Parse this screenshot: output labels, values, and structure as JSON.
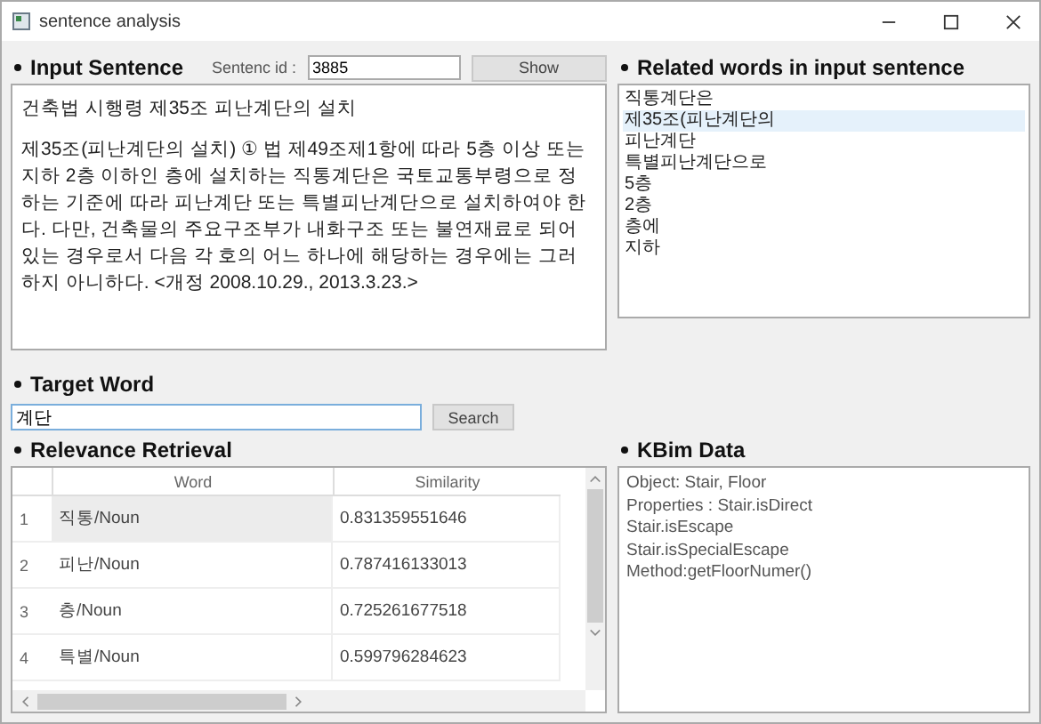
{
  "window": {
    "title": "sentence analysis"
  },
  "input_sentence": {
    "heading": "Input Sentence",
    "id_label": "Sentenc id :",
    "id_value": "3885",
    "show_button": "Show",
    "paragraphs": [
      "건축법 시행령 제35조 피난계단의 설치",
      "제35조(피난계단의 설치) ① 법 제49조제1항에 따라 5층 이상 또는 지하 2층 이하인 층에 설치하는 직통계단은 국토교통부령으로 정하는 기준에 따라 피난계단 또는 특별피난계단으로 설치하여야 한다. 다만, 건축물의 주요구조부가 내화구조 또는 불연재료로 되어 있는 경우로서 다음 각 호의 어느 하나에 해당하는 경우에는 그러하지 아니하다.  <개정 2008.10.29., 2013.3.23.>"
    ]
  },
  "related_words": {
    "heading": "Related words in input sentence",
    "items": [
      {
        "label": "직통계단은",
        "selected": false
      },
      {
        "label": "제35조(피난계단의",
        "selected": true
      },
      {
        "label": "피난계단",
        "selected": false
      },
      {
        "label": "특별피난계단으로",
        "selected": false
      },
      {
        "label": "5층",
        "selected": false
      },
      {
        "label": "2층",
        "selected": false
      },
      {
        "label": "층에",
        "selected": false
      },
      {
        "label": "지하",
        "selected": false
      }
    ]
  },
  "target_word": {
    "heading": "Target Word",
    "value": "계단",
    "search_button": "Search"
  },
  "relevance_retrieval": {
    "heading": "Relevance Retrieval",
    "columns": [
      "Word",
      "Similarity"
    ],
    "rows": [
      {
        "index": "1",
        "word": "직통/Noun",
        "similarity": "0.831359551646",
        "selected": true
      },
      {
        "index": "2",
        "word": "피난/Noun",
        "similarity": "0.787416133013",
        "selected": false
      },
      {
        "index": "3",
        "word": "층/Noun",
        "similarity": "0.725261677518",
        "selected": false
      },
      {
        "index": "4",
        "word": "특별/Noun",
        "similarity": "0.599796284623",
        "selected": false
      }
    ]
  },
  "kbim_data": {
    "heading": "KBim Data",
    "lines": [
      "Object: Stair, Floor",
      "Properties : Stair.isDirect",
      "Stair.isEscape",
      "Stair.isSpecialEscape",
      "Method:getFloorNumer()"
    ]
  }
}
